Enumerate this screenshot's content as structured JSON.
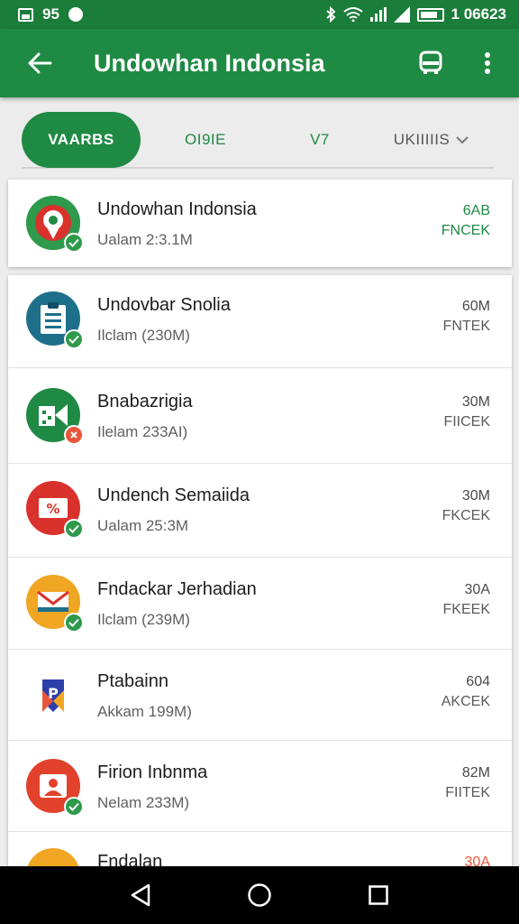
{
  "status_bar": {
    "left_text": "95",
    "right_text": "1 06623",
    "icons": [
      "image-icon",
      "notification-icon",
      "bluetooth-icon",
      "wifi-icon",
      "data-icon",
      "signal-icon",
      "battery-icon"
    ]
  },
  "app_bar": {
    "title": "Undowhan Indonsia",
    "icons": [
      "back-arrow-icon",
      "bus-icon",
      "more-vert-icon"
    ]
  },
  "tabs": [
    {
      "label": "VAARBS",
      "active": true
    },
    {
      "label": "OI9IE",
      "active": false
    },
    {
      "label": "V7",
      "active": false
    },
    {
      "label": "UKIIIIIS",
      "active": false,
      "has_dropdown": true
    }
  ],
  "featured": {
    "name": "Undowhan Indonsia",
    "sub": "Ualam 2:3.1M",
    "size": "6AB",
    "status": "FNCEK",
    "icon": "map-pin-icon",
    "icon_color": "#2e9a4c",
    "badge": "check-icon"
  },
  "apps": [
    {
      "name": "Undovbar Snolia",
      "sub": "Ilclam (230M)",
      "size": "60M",
      "status": "FNTEK",
      "icon": "clipboard-icon",
      "icon_color": "#1e6f8a",
      "badge": "check-icon",
      "badge_color": "#2e9a4c"
    },
    {
      "name": "Bnabazrigia",
      "sub": "Ilelam 233AI)",
      "size": "30M",
      "status": "FIICEK",
      "icon": "slides-icon",
      "icon_color": "#1f8a44",
      "badge": "close-icon",
      "badge_color": "#e8563a"
    },
    {
      "name": "Undench Semaiida",
      "sub": "Ualam 25:3M",
      "size": "30M",
      "status": "FKCEK",
      "icon": "percent-icon",
      "icon_color": "#d9322c",
      "badge": "check-icon",
      "badge_color": "#2e9a4c"
    },
    {
      "name": "Fndackar Jerhadian",
      "sub": "Ilclam (239M)",
      "size": "30A",
      "status": "FKEEK",
      "icon": "mail-icon",
      "icon_color": "#f0a623",
      "badge": "check-icon",
      "badge_color": "#2e9a4c"
    },
    {
      "name": "Ptabainn",
      "sub": "Akkam 199M)",
      "size": "604",
      "status": "AKCEK",
      "icon": "p-logo-icon",
      "icon_color": "#ffffff",
      "badge": "",
      "badge_color": ""
    },
    {
      "name": "Firion Inbnma",
      "sub": "Nelam 233M)",
      "size": "82M",
      "status": "FIITEK",
      "icon": "person-photo-icon",
      "icon_color": "#e2412b",
      "badge": "check-icon",
      "badge_color": "#2e9a4c"
    },
    {
      "name": "Fndalan",
      "sub": "",
      "size": "30A",
      "status": "",
      "icon": "partial-app-icon",
      "icon_color": "#f0a623",
      "badge": "",
      "badge_color": ""
    }
  ],
  "nav_bar": {
    "icons": [
      "nav-back-icon",
      "nav-home-icon",
      "nav-recents-icon"
    ]
  },
  "colors": {
    "primary": "#1f8a44",
    "primary_dark": "#1b7d3a",
    "accent_red": "#e8563a"
  }
}
